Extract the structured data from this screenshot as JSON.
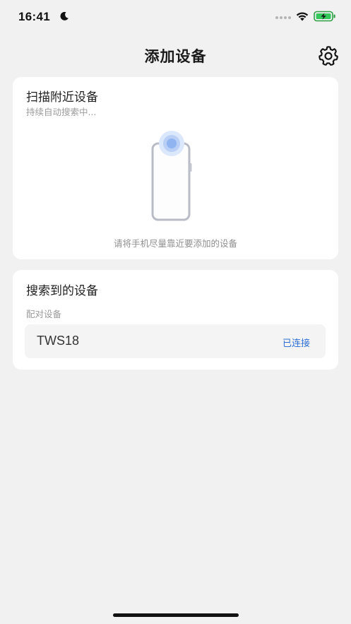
{
  "status_bar": {
    "time": "16:41",
    "icons": [
      "moon-icon",
      "signal-icon",
      "wifi-icon",
      "battery-charging-icon"
    ]
  },
  "header": {
    "title": "添加设备",
    "settings_icon": "gear-icon"
  },
  "scan_card": {
    "title": "扫描附近设备",
    "subtitle": "持续自动搜索中...",
    "illustration": "phone-scanning-icon",
    "hint": "请将手机尽量靠近要添加的设备"
  },
  "found_card": {
    "title": "搜索到的设备",
    "section_label": "配对设备",
    "devices": [
      {
        "name": "TWS18",
        "status": "已连接"
      }
    ]
  },
  "colors": {
    "background": "#f1f1f1",
    "card": "#ffffff",
    "accent": "#2d6fd6",
    "scan_pulse": "#8fb4f0"
  }
}
